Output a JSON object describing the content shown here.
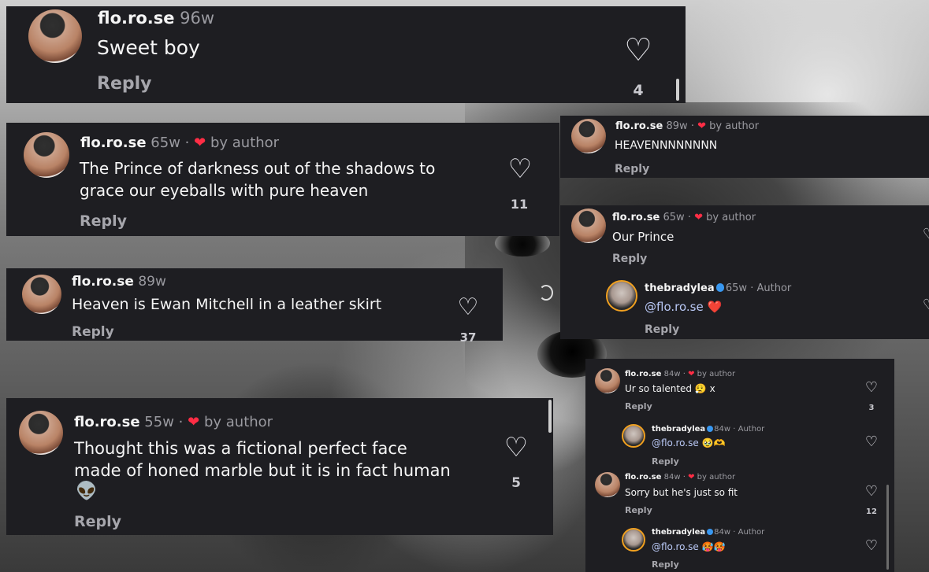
{
  "card1": {
    "user": "flo.ro.se",
    "age": "96w",
    "text": "Sweet boy",
    "reply": "Reply",
    "likes": "4"
  },
  "card2": {
    "user": "flo.ro.se",
    "age": "65w",
    "sep": "·",
    "by": "by author",
    "line1": "The Prince of darkness out of the shadows to",
    "line2": "grace our eyeballs with pure heaven",
    "reply": "Reply",
    "likes": "11"
  },
  "card3": {
    "user": "flo.ro.se",
    "age": "89w",
    "text": "Heaven is Ewan Mitchell in a leather skirt",
    "reply": "Reply",
    "likes": "37"
  },
  "card4": {
    "user": "flo.ro.se",
    "age": "55w",
    "sep": "·",
    "by": "by author",
    "line1": "Thought this was a fictional perfect face",
    "line2": "made of honed marble but it is in fact human",
    "emoji": "👽",
    "reply": "Reply",
    "likes": "5"
  },
  "card5": {
    "user": "flo.ro.se",
    "age": "89w",
    "sep": "·",
    "by": "by author",
    "text": "HEAVENNNNNNNN",
    "reply": "Reply"
  },
  "card6": {
    "user": "flo.ro.se",
    "age": "65w",
    "sep": "·",
    "by": "by author",
    "text": "Our Prince",
    "reply": "Reply",
    "sub": {
      "user": "thebradylea",
      "age": "65w",
      "sep": "·",
      "role": "Author",
      "mention": "@flo.ro.se",
      "emoji": "❤️",
      "reply": "Reply"
    }
  },
  "card7": {
    "c1": {
      "user": "flo.ro.se",
      "age": "84w",
      "sep": "·",
      "by": "by author",
      "text": "Ur so talented",
      "emoji": "😮‍💨 x",
      "reply": "Reply",
      "likes": "3"
    },
    "r1": {
      "user": "thebradylea",
      "age": "84w",
      "sep": "·",
      "role": "Author",
      "mention": "@flo.ro.se",
      "emoji": "🥹🫶",
      "reply": "Reply"
    },
    "c2": {
      "user": "flo.ro.se",
      "age": "84w",
      "sep": "·",
      "by": "by author",
      "text": "Sorry but he's just so fit",
      "reply": "Reply",
      "likes": "12"
    },
    "r2": {
      "user": "thebradylea",
      "age": "84w",
      "sep": "·",
      "role": "Author",
      "mention": "@flo.ro.se",
      "emoji": "🥵🥵",
      "reply": "Reply"
    }
  },
  "icons": {
    "heart_outline": "♡",
    "heart_filled": "❤"
  },
  "colors": {
    "card_bg": "#1e1e22",
    "author_heart": "#ff2d45",
    "verified": "#3897f0",
    "meta": "#9a9aa0"
  }
}
